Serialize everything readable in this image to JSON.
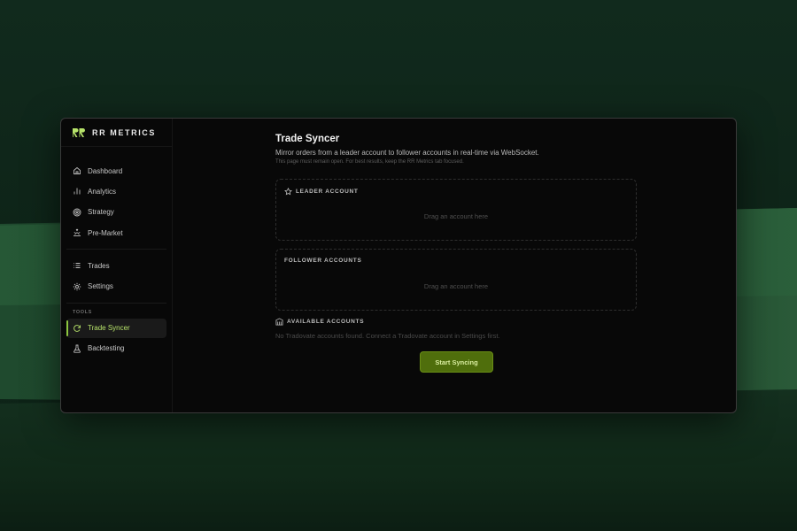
{
  "app": {
    "brand": "RR METRICS"
  },
  "sidebar": {
    "main_items": [
      {
        "label": "Dashboard",
        "icon": "home-icon"
      },
      {
        "label": "Analytics",
        "icon": "bar-chart-icon"
      },
      {
        "label": "Strategy",
        "icon": "target-icon"
      },
      {
        "label": "Pre-Market",
        "icon": "sunrise-icon"
      }
    ],
    "secondary_items": [
      {
        "label": "Trades",
        "icon": "list-icon"
      },
      {
        "label": "Settings",
        "icon": "gear-icon"
      }
    ],
    "tools_label": "TOOLS",
    "tools_items": [
      {
        "label": "Trade Syncer",
        "icon": "refresh-icon",
        "active": true
      },
      {
        "label": "Backtesting",
        "icon": "flask-icon"
      }
    ]
  },
  "page": {
    "title": "Trade Syncer",
    "description": "Mirror orders from a leader account to follower accounts in real-time via WebSocket.",
    "note": "This page must remain open. For best results, keep the RR Metrics tab focused."
  },
  "leader": {
    "heading": "LEADER ACCOUNT",
    "placeholder": "Drag an account here"
  },
  "followers": {
    "heading": "FOLLOWER ACCOUNTS",
    "placeholder": "Drag an account here"
  },
  "available": {
    "heading": "AVAILABLE ACCOUNTS",
    "empty_text": "No Tradovate accounts found. Connect a Tradovate account in Settings first."
  },
  "actions": {
    "start_label": "Start Syncing"
  },
  "colors": {
    "accent": "#b7e36a",
    "button_bg": "#4f6e0c",
    "window_bg": "#080808"
  }
}
